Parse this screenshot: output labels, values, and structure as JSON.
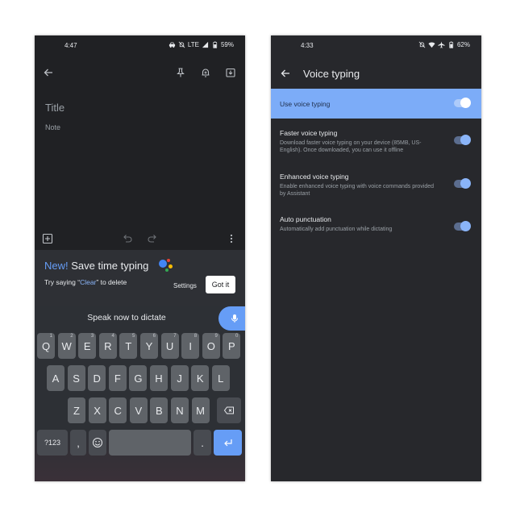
{
  "left_screen": {
    "status": {
      "time": "4:47",
      "network": "LTE",
      "battery": "59%"
    },
    "toolbar": {
      "back_icon": "arrow-left-icon",
      "pin_icon": "pin-icon",
      "reminder_icon": "bell-plus-icon",
      "archive_icon": "archive-icon"
    },
    "note": {
      "title_placeholder": "Title",
      "body_placeholder": "Note"
    },
    "bottom_bar": {
      "add_icon": "plus-box-icon",
      "undo_icon": "undo-icon",
      "redo_icon": "redo-icon",
      "more_icon": "more-vert-icon"
    },
    "promo": {
      "new_label": "New!",
      "title": " Save time typing",
      "hint_prefix": "Try saying “",
      "hint_keyword": "Clear",
      "hint_suffix": "” to delete",
      "settings_label": "Settings",
      "got_it_label": "Got it"
    },
    "keyboard": {
      "speak_label": "Speak now to dictate",
      "row1": [
        {
          "key": "Q",
          "hint": "1"
        },
        {
          "key": "W",
          "hint": "2"
        },
        {
          "key": "E",
          "hint": "3"
        },
        {
          "key": "R",
          "hint": "4"
        },
        {
          "key": "T",
          "hint": "5"
        },
        {
          "key": "Y",
          "hint": "6"
        },
        {
          "key": "U",
          "hint": "7"
        },
        {
          "key": "I",
          "hint": "8"
        },
        {
          "key": "O",
          "hint": "9"
        },
        {
          "key": "P",
          "hint": "0"
        }
      ],
      "row2": [
        "A",
        "S",
        "D",
        "F",
        "G",
        "H",
        "J",
        "K",
        "L"
      ],
      "row3": [
        "Z",
        "X",
        "C",
        "V",
        "B",
        "N",
        "M"
      ],
      "symbols_label": "?123",
      "comma_label": ",",
      "period_label": "."
    }
  },
  "right_screen": {
    "status": {
      "time": "4:33",
      "battery": "62%"
    },
    "title": "Voice typing",
    "master": {
      "label": "Use voice typing",
      "enabled": true
    },
    "settings": [
      {
        "title": "Faster voice typing",
        "subtitle": "Download faster voice typing on your device (85MB, US-English). Once downloaded, you can use it offline",
        "enabled": true
      },
      {
        "title": "Enhanced voice typing",
        "subtitle": "Enable enhanced voice typing with voice commands provided by Assistant",
        "enabled": true
      },
      {
        "title": "Auto punctuation",
        "subtitle": "Automatically add punctuation while dictating",
        "enabled": true
      }
    ]
  },
  "colors": {
    "accent": "#669df6",
    "accent_light": "#7cacf8",
    "keyboard_key": "#5f6368",
    "google_blue": "#4285f4",
    "google_red": "#ea4335",
    "google_yellow": "#fbbc04",
    "google_green": "#34a853"
  }
}
